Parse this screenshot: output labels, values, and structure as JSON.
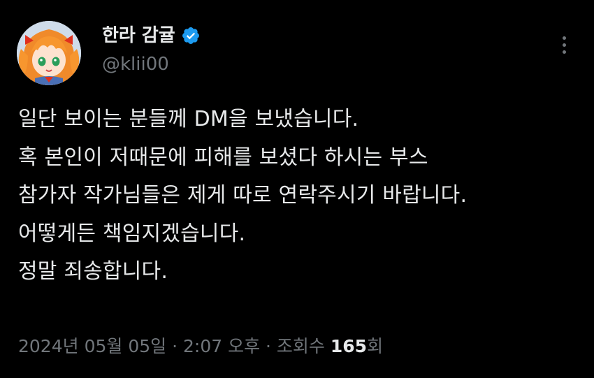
{
  "author": {
    "display_name": "한라 감귤",
    "handle": "@klii00",
    "verified": true,
    "avatar_icon": "anime-avatar-icon",
    "verified_icon": "verified-badge-icon"
  },
  "more_icon": "more-options-icon",
  "body": {
    "lines": [
      "일단 보이는 분들께 DM을 보냈습니다.",
      "혹 본인이 저때문에 피해를 보셨다 하시는 부스",
      "참가자 작가님들은 제게 따로 연락주시기 바랍니다.",
      "어떻게든 책임지겠습니다.",
      "정말 죄송합니다."
    ]
  },
  "meta": {
    "date": "2024년 05월 05일",
    "separator1": " · ",
    "time": "2:07 오후",
    "separator2": " · ",
    "views_label": "조회수 ",
    "views_count": "165",
    "views_suffix": "회"
  },
  "colors": {
    "background": "#000000",
    "text_primary": "#e7e9ea",
    "text_secondary": "#71767b",
    "verified_blue": "#1d9bf0"
  }
}
